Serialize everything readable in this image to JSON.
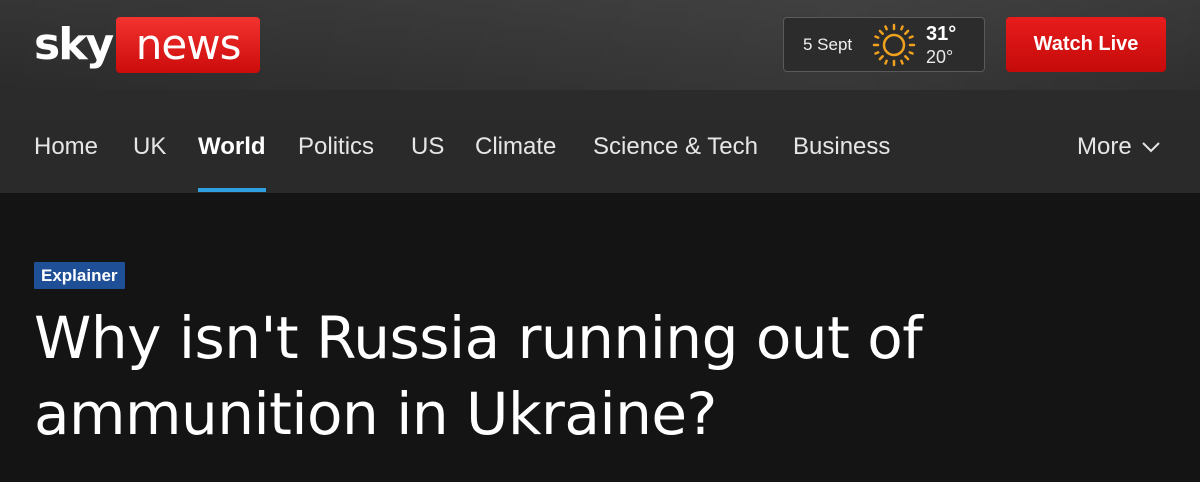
{
  "brand": {
    "sky": "sky",
    "news": "news",
    "accent": "#e0141a"
  },
  "weather": {
    "date": "5 Sept",
    "high": "31°",
    "low": "20°",
    "icon": "sun-icon",
    "icon_color": "#f0a11e"
  },
  "header": {
    "watch_live_label": "Watch Live"
  },
  "nav": {
    "items": [
      {
        "label": "Home",
        "active": false
      },
      {
        "label": "UK",
        "active": false
      },
      {
        "label": "World",
        "active": true
      },
      {
        "label": "Politics",
        "active": false
      },
      {
        "label": "US",
        "active": false
      },
      {
        "label": "Climate",
        "active": false
      },
      {
        "label": "Science & Tech",
        "active": false
      },
      {
        "label": "Business",
        "active": false
      }
    ],
    "more_label": "More",
    "active_color": "#2f9fe0"
  },
  "article": {
    "badge": "Explainer",
    "headline": "Why isn't Russia running out of ammunition in Ukraine?"
  }
}
